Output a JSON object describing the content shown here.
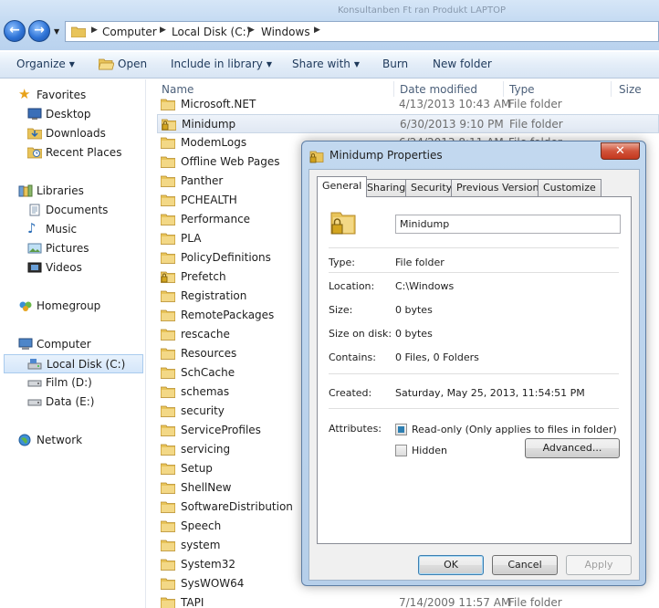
{
  "colors": {
    "accent": "#2d7fb2",
    "close_red": "#c4381e",
    "folder": "#e8c45a"
  },
  "address": {
    "crumbs": [
      "Computer",
      "Local Disk (C:)",
      "Windows"
    ],
    "background_title": "Konsultanben Ft ran Produkt LAPTOP"
  },
  "toolbar": {
    "organize": "Organize",
    "open": "Open",
    "include": "Include in library",
    "share": "Share with",
    "burn": "Burn",
    "new_folder": "New folder"
  },
  "nav": {
    "favorites": "Favorites",
    "desktop": "Desktop",
    "downloads": "Downloads",
    "recent": "Recent Places",
    "libraries": "Libraries",
    "documents": "Documents",
    "music": "Music",
    "pictures": "Pictures",
    "videos": "Videos",
    "homegroup": "Homegroup",
    "computer": "Computer",
    "local_disk": "Local Disk (C:)",
    "film": "Film (D:)",
    "data": "Data (E:)",
    "network": "Network"
  },
  "columns": {
    "name": "Name",
    "date": "Date modified",
    "type": "Type",
    "size": "Size"
  },
  "files": [
    {
      "name": "Microsoft.NET",
      "date": "4/13/2013 10:43 AM",
      "type": "File folder",
      "locked": false
    },
    {
      "name": "Minidump",
      "date": "6/30/2013 9:10 PM",
      "type": "File folder",
      "locked": true
    },
    {
      "name": "ModemLogs",
      "date": "6/24/2013 8:11 AM",
      "type": "File folder",
      "locked": false
    },
    {
      "name": "Offline Web Pages",
      "date": "",
      "type": "",
      "locked": false
    },
    {
      "name": "Panther",
      "date": "",
      "type": "",
      "locked": false
    },
    {
      "name": "PCHEALTH",
      "date": "",
      "type": "",
      "locked": false
    },
    {
      "name": "Performance",
      "date": "",
      "type": "",
      "locked": false
    },
    {
      "name": "PLA",
      "date": "",
      "type": "",
      "locked": false
    },
    {
      "name": "PolicyDefinitions",
      "date": "",
      "type": "",
      "locked": false
    },
    {
      "name": "Prefetch",
      "date": "",
      "type": "",
      "locked": true
    },
    {
      "name": "Registration",
      "date": "",
      "type": "",
      "locked": false
    },
    {
      "name": "RemotePackages",
      "date": "",
      "type": "",
      "locked": false
    },
    {
      "name": "rescache",
      "date": "",
      "type": "",
      "locked": false
    },
    {
      "name": "Resources",
      "date": "",
      "type": "",
      "locked": false
    },
    {
      "name": "SchCache",
      "date": "",
      "type": "",
      "locked": false
    },
    {
      "name": "schemas",
      "date": "",
      "type": "",
      "locked": false
    },
    {
      "name": "security",
      "date": "",
      "type": "",
      "locked": false
    },
    {
      "name": "ServiceProfiles",
      "date": "",
      "type": "",
      "locked": false
    },
    {
      "name": "servicing",
      "date": "",
      "type": "",
      "locked": false
    },
    {
      "name": "Setup",
      "date": "",
      "type": "",
      "locked": false
    },
    {
      "name": "ShellNew",
      "date": "",
      "type": "",
      "locked": false
    },
    {
      "name": "SoftwareDistribution",
      "date": "",
      "type": "",
      "locked": false
    },
    {
      "name": "Speech",
      "date": "",
      "type": "",
      "locked": false
    },
    {
      "name": "system",
      "date": "",
      "type": "",
      "locked": false
    },
    {
      "name": "System32",
      "date": "",
      "type": "",
      "locked": false
    },
    {
      "name": "SysWOW64",
      "date": "",
      "type": "",
      "locked": false
    },
    {
      "name": "TAPI",
      "date": "7/14/2009 11:57 AM",
      "type": "File folder",
      "locked": false
    }
  ],
  "dialog": {
    "title": "Minidump Properties",
    "close_label": "✕",
    "tabs": [
      "General",
      "Sharing",
      "Security",
      "Previous Versions",
      "Customize"
    ],
    "folder_name": "Minidump",
    "labels": {
      "type": "Type:",
      "location": "Location:",
      "size": "Size:",
      "size_on_disk": "Size on disk:",
      "contains": "Contains:",
      "created": "Created:",
      "attributes": "Attributes:"
    },
    "values": {
      "type": "File folder",
      "location": "C:\\Windows",
      "size": "0 bytes",
      "size_on_disk": "0 bytes",
      "contains": "0 Files, 0 Folders",
      "created": "Saturday, May 25, 2013, 11:54:51 PM"
    },
    "readonly_label": "Read-only (Only applies to files in folder)",
    "hidden_label": "Hidden",
    "advanced_label": "Advanced...",
    "ok_label": "OK",
    "cancel_label": "Cancel",
    "apply_label": "Apply"
  }
}
